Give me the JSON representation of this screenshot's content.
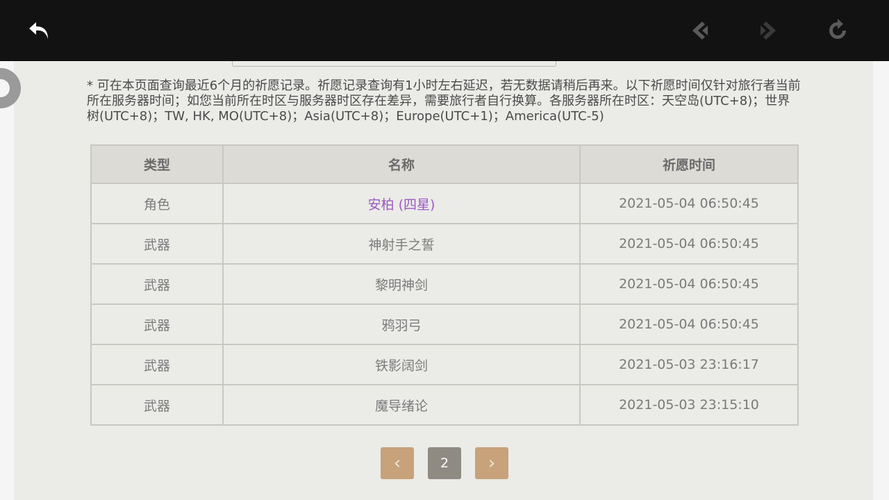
{
  "topbar": {
    "icons": [
      "back-icon",
      "previous-page-icon",
      "next-page-icon",
      "refresh-icon"
    ]
  },
  "notice": "* 可在本页面查询最近6个月的祈愿记录。祈愿记录查询有1小时左右延迟，若无数据请稍后再来。以下祈愿时间仅针对旅行者当前所在服务器时间；如您当前所在时区与服务器时区存在差异，需要旅行者自行换算。各服务器所在时区：天空岛(UTC+8)；世界树(UTC+8)；TW, HK, MO(UTC+8)；Asia(UTC+8)；Europe(UTC+1)；America(UTC-5)",
  "table": {
    "headers": [
      "类型",
      "名称",
      "祈愿时间"
    ],
    "rows": [
      {
        "type": "角色",
        "name": "安柏 (四星)",
        "time": "2021-05-04 06:50:45"
      },
      {
        "type": "武器",
        "name": "神射手之誓",
        "time": "2021-05-04 06:50:45"
      },
      {
        "type": "武器",
        "name": "黎明神剑",
        "time": "2021-05-04 06:50:45"
      },
      {
        "type": "武器",
        "name": "鸦羽弓",
        "time": "2021-05-04 06:50:45"
      },
      {
        "type": "武器",
        "name": "铁影阔剑",
        "time": "2021-05-03 23:16:17"
      },
      {
        "type": "武器",
        "name": "魔导绪论",
        "time": "2021-05-03 23:15:10"
      }
    ]
  },
  "pagination": {
    "current_page": "2",
    "prev_symbol": "‹",
    "next_symbol": "›"
  },
  "colors": {
    "topbar": "#121212",
    "four_star_name": "#9b59c4",
    "pager_arrow": "#c7a27b",
    "pager_current": "#8f8b82"
  }
}
